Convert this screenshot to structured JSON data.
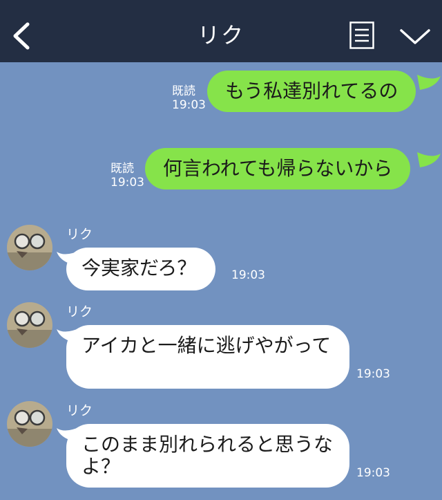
{
  "header": {
    "title": "リク"
  },
  "messages": [
    {
      "side": "out",
      "read": "既読",
      "time": "19:03",
      "text": "もう私達別れてるの"
    },
    {
      "side": "out",
      "read": "既読",
      "time": "19:03",
      "text": "何言われても帰らないから"
    },
    {
      "side": "in",
      "sender": "リク",
      "time": "19:03",
      "text": "今実家だろ？"
    },
    {
      "side": "in",
      "sender": "リク",
      "time": "19:03",
      "text": "アイカと一緒に逃げやがって"
    },
    {
      "side": "in",
      "sender": "リク",
      "time": "19:03",
      "text": "このまま別れられると思うなよ？"
    }
  ],
  "colors": {
    "header_bg": "#232e43",
    "chat_bg": "#7292c0",
    "outgoing_bubble": "#86e34a",
    "incoming_bubble": "#ffffff"
  },
  "icons": {
    "back": "chevron-left-icon",
    "menu": "notes-icon",
    "more": "chevron-down-icon",
    "avatar": "sunglasses-photo-avatar"
  }
}
